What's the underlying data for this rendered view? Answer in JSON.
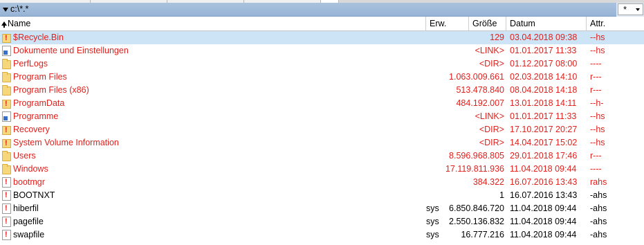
{
  "path": "c:\\*.*",
  "filter": "*",
  "columns": {
    "name": "Name",
    "ext": "Erw.",
    "size": "Größe",
    "date": "Datum",
    "attr": "Attr."
  },
  "rows": [
    {
      "name": "$Recycle.Bin",
      "ext": "",
      "size": "129",
      "date": "03.04.2018 09:38",
      "attr": "--hs",
      "icon": "system-folder-icon",
      "color": "red",
      "selected": true
    },
    {
      "name": "Dokumente und Einstellungen",
      "ext": "",
      "size": "<LINK>",
      "date": "01.01.2017 11:33",
      "attr": "--hs",
      "icon": "link-icon",
      "color": "red"
    },
    {
      "name": "PerfLogs",
      "ext": "",
      "size": "<DIR>",
      "date": "01.12.2017 08:00",
      "attr": "----",
      "icon": "folder-icon",
      "color": "red"
    },
    {
      "name": "Program Files",
      "ext": "",
      "size": "1.063.009.661",
      "date": "02.03.2018 14:10",
      "attr": "r---",
      "icon": "folder-icon",
      "color": "red"
    },
    {
      "name": "Program Files (x86)",
      "ext": "",
      "size": "513.478.840",
      "date": "08.04.2018 14:18",
      "attr": "r---",
      "icon": "folder-icon",
      "color": "red"
    },
    {
      "name": "ProgramData",
      "ext": "",
      "size": "484.192.007",
      "date": "13.01.2018 14:11",
      "attr": "--h-",
      "icon": "system-folder-icon",
      "color": "red"
    },
    {
      "name": "Programme",
      "ext": "",
      "size": "<LINK>",
      "date": "01.01.2017 11:33",
      "attr": "--hs",
      "icon": "link-icon",
      "color": "red"
    },
    {
      "name": "Recovery",
      "ext": "",
      "size": "<DIR>",
      "date": "17.10.2017 20:27",
      "attr": "--hs",
      "icon": "system-folder-icon",
      "color": "red"
    },
    {
      "name": "System Volume Information",
      "ext": "",
      "size": "<DIR>",
      "date": "14.04.2017 15:02",
      "attr": "--hs",
      "icon": "system-folder-icon",
      "color": "red"
    },
    {
      "name": "Users",
      "ext": "",
      "size": "8.596.968.805",
      "date": "29.01.2018 17:46",
      "attr": "r---",
      "icon": "folder-icon",
      "color": "red"
    },
    {
      "name": "Windows",
      "ext": "",
      "size": "17.119.811.936",
      "date": "11.04.2018 09:44",
      "attr": "----",
      "icon": "folder-icon",
      "color": "red"
    },
    {
      "name": "bootmgr",
      "ext": "",
      "size": "384.322",
      "date": "16.07.2016 13:43",
      "attr": "rahs",
      "icon": "system-file-icon",
      "color": "red"
    },
    {
      "name": "BOOTNXT",
      "ext": "",
      "size": "1",
      "date": "16.07.2016 13:43",
      "attr": "-ahs",
      "icon": "system-file-icon",
      "color": "black"
    },
    {
      "name": "hiberfil",
      "ext": "sys",
      "size": "6.850.846.720",
      "date": "11.04.2018 09:44",
      "attr": "-ahs",
      "icon": "system-file-icon",
      "color": "black"
    },
    {
      "name": "pagefile",
      "ext": "sys",
      "size": "2.550.136.832",
      "date": "11.04.2018 09:44",
      "attr": "-ahs",
      "icon": "system-file-icon",
      "color": "black"
    },
    {
      "name": "swapfile",
      "ext": "sys",
      "size": "16.777.216",
      "date": "11.04.2018 09:44",
      "attr": "-ahs",
      "icon": "system-file-icon",
      "color": "black"
    }
  ]
}
